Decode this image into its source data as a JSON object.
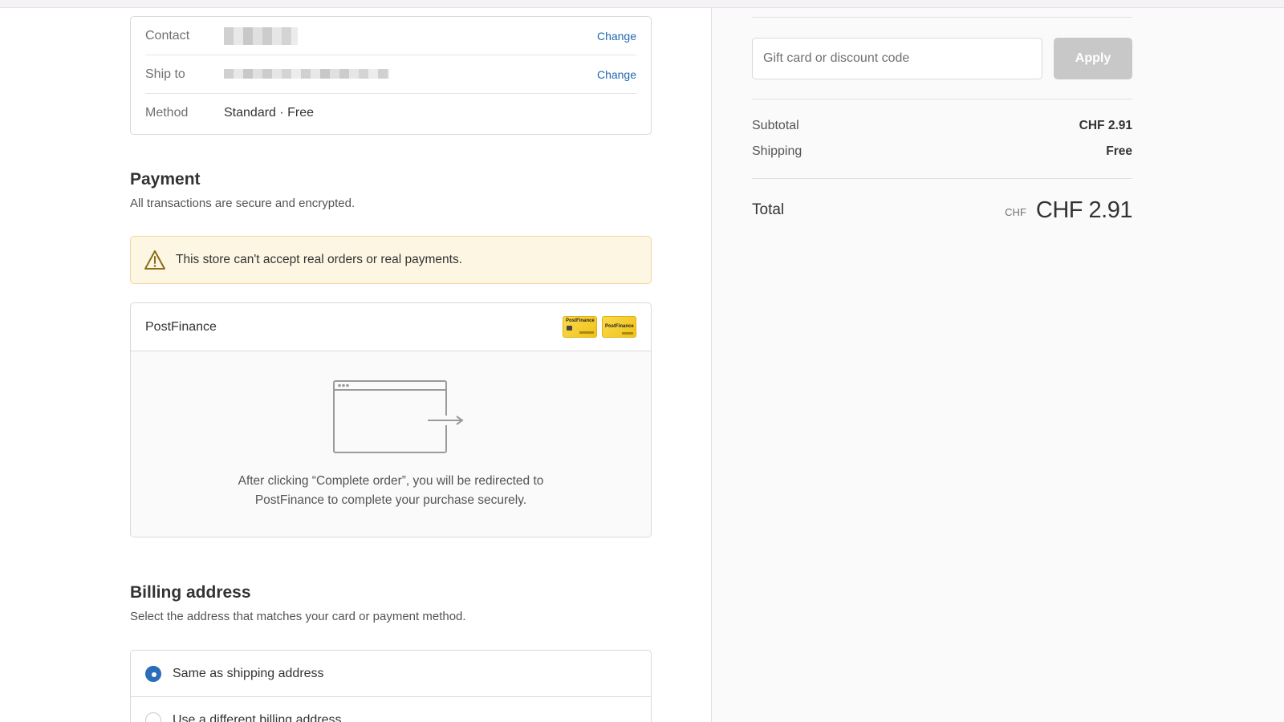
{
  "review": {
    "contact_label": "Contact",
    "ship_label": "Ship to",
    "method_label": "Method",
    "method_value": "Standard · Free",
    "change_label": "Change"
  },
  "payment": {
    "title": "Payment",
    "subtitle": "All transactions are secure and encrypted.",
    "warning": "This store can't accept real orders or real payments.",
    "provider": "PostFinance",
    "card_logo_text": "PostFinance",
    "redirect_text_line1": "After clicking “Complete order”, you will be redirected to",
    "redirect_text_line2": "PostFinance to complete your purchase securely."
  },
  "billing": {
    "title": "Billing address",
    "subtitle": "Select the address that matches your card or payment method.",
    "options": [
      {
        "label": "Same as shipping address",
        "selected": true
      },
      {
        "label": "Use a different billing address",
        "selected": false
      }
    ]
  },
  "summary": {
    "discount_placeholder": "Gift card or discount code",
    "apply_label": "Apply",
    "subtotal_label": "Subtotal",
    "subtotal_value": "CHF 2.91",
    "shipping_label": "Shipping",
    "shipping_value": "Free",
    "total_label": "Total",
    "total_currency": "CHF",
    "total_value": "CHF 2.91"
  },
  "colors": {
    "link": "#1f67b2",
    "warning_bg": "#fdf6e3",
    "radio_selected": "#2a6ebb",
    "apply_disabled": "#c8c8c8",
    "card_yellow": "#f9d94a"
  },
  "icons": [
    "warning-triangle-icon",
    "redirect-browser-icon",
    "postfinance-card-logo"
  ]
}
